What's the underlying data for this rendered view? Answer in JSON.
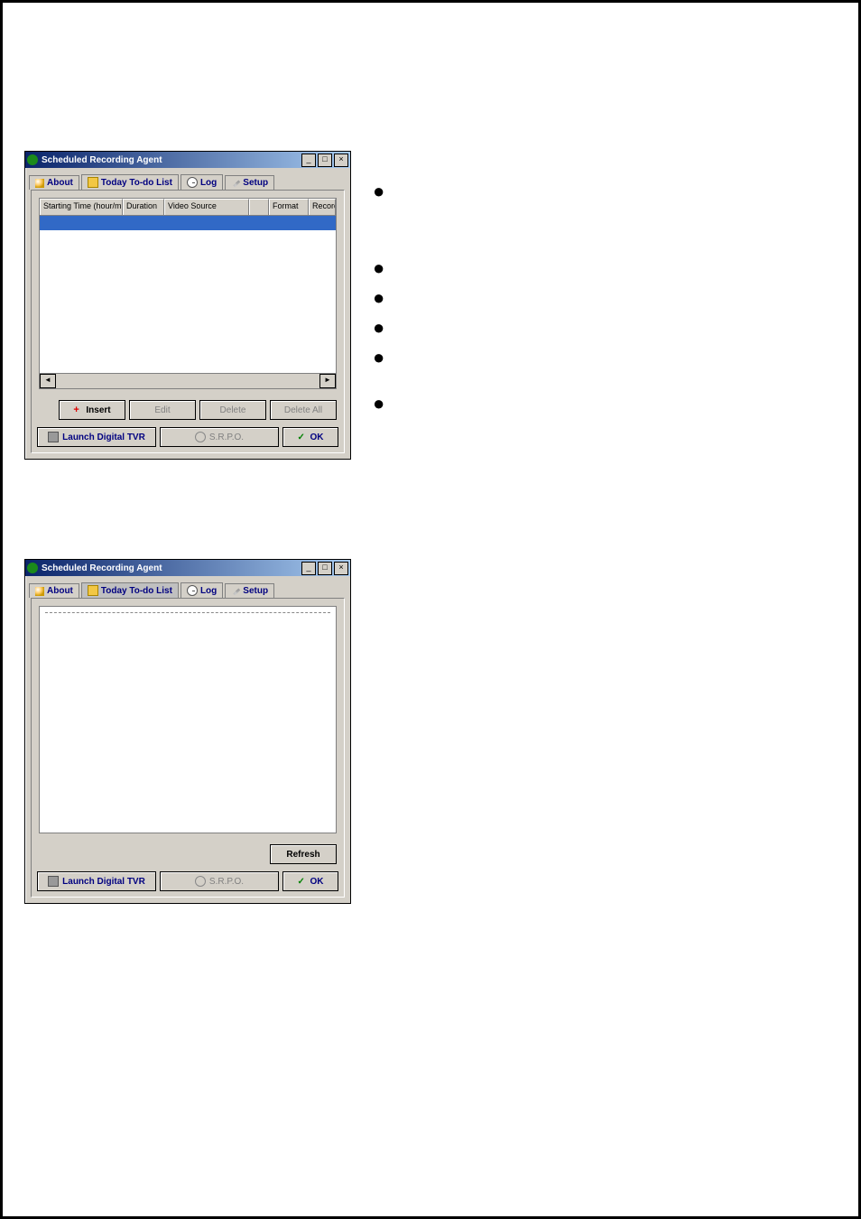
{
  "window_title": "Scheduled Recording Agent",
  "tabs": {
    "about": "About",
    "todo": "Today To-do List",
    "log": "Log",
    "setup": "Setup"
  },
  "columns": {
    "c1": "Starting Time (hour/minute)",
    "c2": "Duration",
    "c3": "Video Source",
    "c4": " ",
    "c5": "Format",
    "c6": "Record"
  },
  "buttons": {
    "insert": "Insert",
    "edit": "Edit",
    "delete": "Delete",
    "delete_all": "Delete All",
    "launch": "Launch Digital TVR",
    "srpo": "S.R.P.O.",
    "ok": "OK",
    "refresh": "Refresh"
  },
  "titlebar_buttons": {
    "min": "_",
    "max": "□",
    "close": "×"
  }
}
